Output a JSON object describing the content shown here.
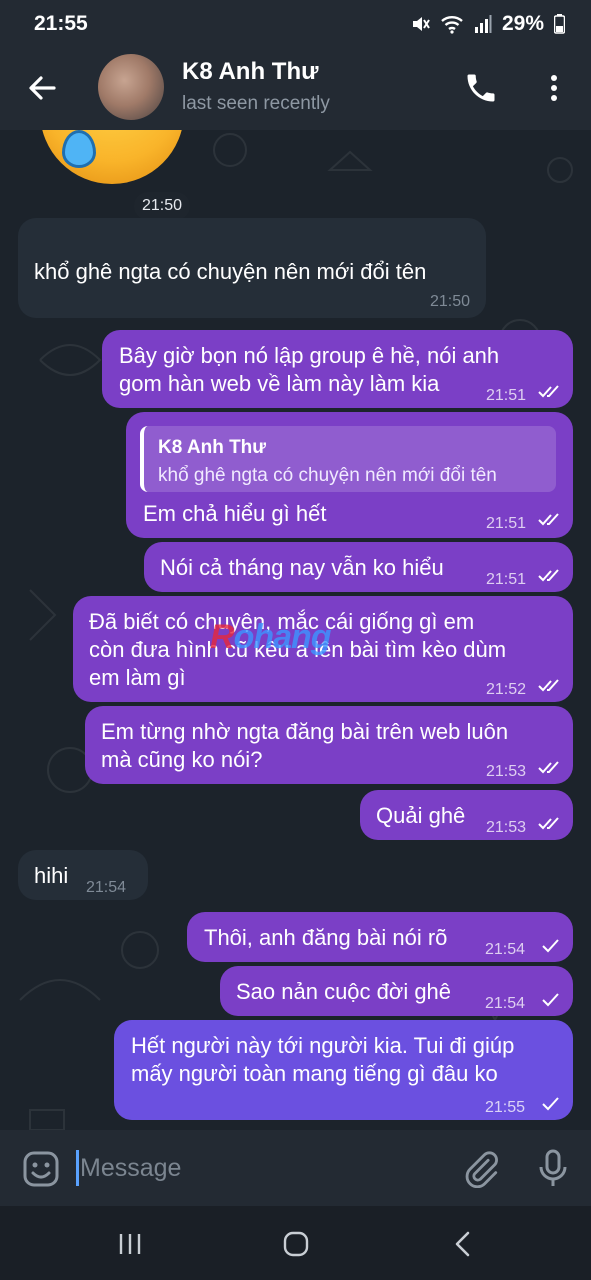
{
  "status_bar": {
    "time": "21:55",
    "battery": "29%"
  },
  "header": {
    "contact_name": "K8 Anh Thư",
    "contact_status": "last seen recently"
  },
  "sticker": {
    "time": "21:50"
  },
  "messages": [
    {
      "dir": "in",
      "text": "khổ ghê ngta có chuyện nên mới đổi tên",
      "time": "21:50"
    },
    {
      "dir": "out",
      "text": "Bây giờ bọn nó lập group ê hề, nói anh",
      "text2": "gom hàn web về làm này làm kia",
      "time": "21:51",
      "status": "read"
    },
    {
      "dir": "out",
      "reply_name": "K8 Anh Thư",
      "reply_text": "khổ ghê ngta có chuyện nên mới đổi tên",
      "text": "Em chả hiểu gì hết",
      "time": "21:51",
      "status": "read"
    },
    {
      "dir": "out",
      "text": "Nói cả tháng nay vẫn ko hiểu",
      "time": "21:51",
      "status": "read"
    },
    {
      "dir": "out",
      "text": "Đã biết có chuyện, mắc cái giống gì em",
      "text2": "còn đưa hình cũ kêu a lên bài tìm kèo dùm",
      "text3": "em làm gì",
      "time": "21:52",
      "status": "read"
    },
    {
      "dir": "out",
      "text": "Em từng nhờ ngta đăng bài trên web luôn",
      "text2": "mà cũng ko nói?",
      "time": "21:53",
      "status": "read"
    },
    {
      "dir": "out",
      "text": "Quải ghê",
      "time": "21:53",
      "status": "read"
    },
    {
      "dir": "in",
      "text": "hihi",
      "time": "21:54"
    },
    {
      "dir": "out",
      "text": "Thôi, anh đăng bài nói rõ",
      "time": "21:54",
      "status": "sent"
    },
    {
      "dir": "out",
      "text": "Sao nản cuộc đời ghê",
      "time": "21:54",
      "status": "sent"
    },
    {
      "dir": "out",
      "text": "Hết người này tới người kia. Tui đi giúp",
      "text2": "mấy người toàn mang tiếng gì đâu ko",
      "time": "21:55",
      "status": "sent"
    }
  ],
  "watermark": {
    "part1": "R",
    "part2": "ohang"
  },
  "input": {
    "placeholder": "Message"
  },
  "colors": {
    "outgoing": "#7b3fc6",
    "outgoing_last": "#6b50e0",
    "incoming": "#252e38",
    "header": "#232a33",
    "cursor": "#5aa2ff"
  },
  "icons": [
    "back-arrow-icon",
    "phone-icon",
    "more-vertical-icon",
    "emoji-icon",
    "attach-icon",
    "mic-icon",
    "double-check-icon",
    "single-check-icon",
    "nav-recent-icon",
    "nav-home-icon",
    "nav-back-icon"
  ]
}
